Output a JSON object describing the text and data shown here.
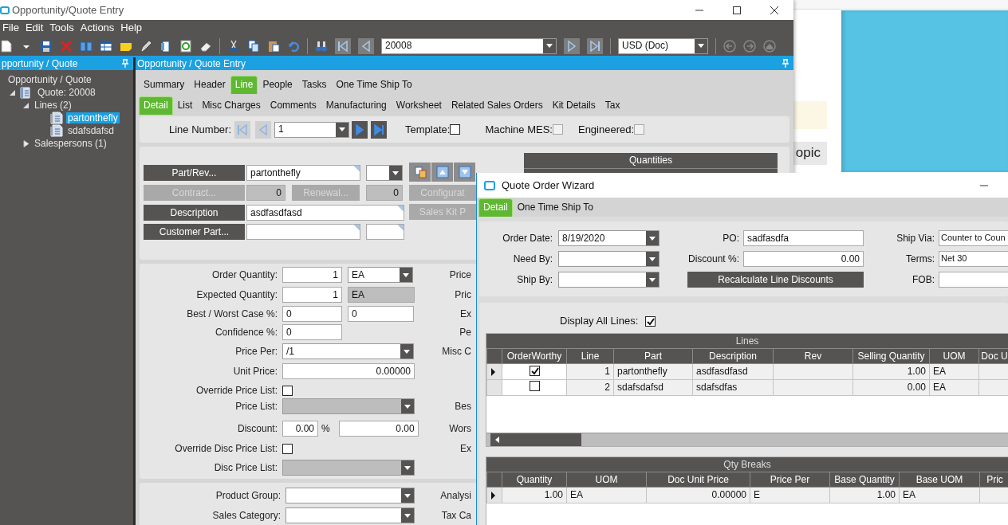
{
  "window": {
    "title": "Opportunity/Quote Entry"
  },
  "menu": [
    "File",
    "Edit",
    "Tools",
    "Actions",
    "Help"
  ],
  "toolbar": {
    "record": "20008",
    "currency": "USD (Doc)"
  },
  "tree_panel": {
    "title": "pportunity / Quote",
    "items": [
      {
        "label": "Opportunity / Quote",
        "selected": false,
        "children": [
          {
            "label": "Quote: 20008",
            "kind": "quote",
            "expanded": true,
            "selected": false,
            "children": [
              {
                "label": "Lines (2)",
                "expanded": true,
                "selected": false,
                "children": [
                  {
                    "label": "partonthefly",
                    "kind": "line",
                    "selected": true
                  },
                  {
                    "label": "sdafsdafsd",
                    "kind": "line",
                    "selected": false
                  }
                ]
              },
              {
                "label": "Salespersons (1)",
                "expanded": false,
                "selected": false
              }
            ]
          }
        ]
      }
    ]
  },
  "entry": {
    "title": "Opportunity / Quote Entry",
    "tabs": [
      {
        "label": "Summary",
        "selected": false
      },
      {
        "label": "Header",
        "selected": false
      },
      {
        "label": "Line",
        "selected": true
      },
      {
        "label": "People",
        "selected": false
      },
      {
        "label": "Tasks",
        "selected": false
      },
      {
        "label": "One Time Ship To",
        "selected": false
      }
    ],
    "subtabs": [
      {
        "label": "Detail",
        "selected": true
      },
      {
        "label": "List",
        "selected": false
      },
      {
        "label": "Misc Charges",
        "selected": false
      },
      {
        "label": "Comments",
        "selected": false
      },
      {
        "label": "Manufacturing",
        "selected": false
      },
      {
        "label": "Worksheet",
        "selected": false
      },
      {
        "label": "Related Sales Orders",
        "selected": false
      },
      {
        "label": "Kit Details",
        "selected": false
      },
      {
        "label": "Tax",
        "selected": false
      }
    ],
    "line_bar": {
      "label": "Line Number:",
      "value": "1",
      "nav": [
        {
          "disabled": true
        },
        {
          "disabled": true
        },
        {
          "disabled": false
        },
        {
          "disabled": false
        }
      ],
      "checks": [
        {
          "label": "Template:",
          "checked": false,
          "disabled": false
        },
        {
          "label": "Machine MES:",
          "checked": false,
          "disabled": true
        },
        {
          "label": "Engineered:",
          "checked": false,
          "disabled": true
        }
      ]
    },
    "part": {
      "part_button": {
        "label": "Part/Rev...",
        "disabled": false
      },
      "part_value": "partonthefly",
      "contract_button": {
        "label": "Contract...",
        "disabled": true
      },
      "contract_value": "0",
      "renewal_button": {
        "label": "Renewal...",
        "disabled": true
      },
      "renewal_value": "0",
      "description_button": {
        "label": "Description",
        "disabled": false
      },
      "description_value": "asdfasdfasd",
      "customer_part_button": {
        "label": "Customer Part...",
        "disabled": false
      },
      "side_buttons": [
        {
          "label": "Configurat",
          "disabled": true
        },
        {
          "label": "Sales Kit P",
          "disabled": true
        }
      ],
      "quantities_title": "Quantities"
    },
    "details": [
      {
        "label": "Order Quantity:",
        "controls": [
          {
            "kind": "number",
            "value": "1"
          },
          {
            "kind": "combo",
            "value": "EA"
          }
        ],
        "side": "Price"
      },
      {
        "label": "Expected Quantity:",
        "controls": [
          {
            "kind": "number",
            "value": "1"
          },
          {
            "kind": "text",
            "value": "EA",
            "disabled": true
          }
        ],
        "side": "Pric"
      },
      {
        "label": "Best / Worst Case %:",
        "controls": [
          {
            "kind": "text",
            "value": "0"
          },
          {
            "kind": "text",
            "value": "0"
          }
        ],
        "side": "Ex"
      },
      {
        "label": "Confidence %:",
        "controls": [
          {
            "kind": "text",
            "value": "0"
          }
        ],
        "side": "Pe"
      },
      {
        "label": "Price Per:",
        "controls": [
          {
            "kind": "combo",
            "value": "/1"
          }
        ],
        "side": "Misc C"
      },
      {
        "label": "Unit Price:",
        "controls": [
          {
            "kind": "number",
            "value": "0.00000"
          }
        ]
      },
      {
        "label": "Override Price List:",
        "controls": [
          {
            "kind": "checkbox",
            "checked": false
          }
        ]
      },
      {
        "label": "Price List:",
        "controls": [
          {
            "kind": "combo",
            "disabled": true
          }
        ],
        "side": "Bes"
      },
      {
        "label": "Discount:",
        "controls": [
          {
            "kind": "number",
            "value": "0.00"
          },
          {
            "kind": "unit",
            "value": "%"
          },
          {
            "kind": "number",
            "value": "0.00"
          }
        ],
        "side": "Wors"
      },
      {
        "label": "Override Disc Price List:",
        "controls": [
          {
            "kind": "checkbox",
            "checked": false
          }
        ],
        "side": "Ex"
      },
      {
        "label": "Disc Price List:",
        "controls": [
          {
            "kind": "combo",
            "disabled": true
          }
        ]
      }
    ],
    "bottom": [
      {
        "label": "Product Group:",
        "controls": [
          {
            "kind": "combo"
          }
        ],
        "side": "Analysi"
      },
      {
        "label": "Sales Category:",
        "controls": [
          {
            "kind": "combo"
          }
        ],
        "side": "Tax Ca"
      }
    ]
  },
  "wizard": {
    "title": "Quote Order Wizard",
    "tabs": [
      {
        "label": "Detail",
        "selected": true
      },
      {
        "label": "One Time Ship To",
        "selected": false
      }
    ],
    "columns": [
      [
        {
          "label": "Order Date:",
          "kind": "combo",
          "value": "8/19/2020"
        },
        {
          "label": "Need By:",
          "kind": "combo"
        },
        {
          "label": "Ship By:",
          "kind": "combo"
        }
      ],
      [
        {
          "label": "PO:",
          "kind": "text",
          "value": "sadfasdfa"
        },
        {
          "label": "Discount %:",
          "kind": "number",
          "value": "0.00"
        },
        {
          "kind": "button",
          "label": "Recalculate Line Discounts"
        }
      ],
      [
        {
          "label": "Ship Via:",
          "kind": "text",
          "value": "Counter to Coun"
        },
        {
          "label": "Terms:",
          "kind": "text",
          "value": "Net 30"
        },
        {
          "label": "FOB:",
          "kind": "text"
        }
      ]
    ],
    "display_all_lines": {
      "label": "Display All Lines:",
      "checked": true
    },
    "lines": {
      "title": "Lines",
      "columns": [
        "OrderWorthy",
        "Line",
        "Part",
        "Description",
        "Rev",
        "Selling Quantity",
        "UOM",
        "Doc U"
      ],
      "rows": [
        {
          "current": true,
          "order_worthy": true,
          "line": "1",
          "part": "partonthefly",
          "description": "asdfasdfasd",
          "selling_quantity": "1.00",
          "uom": "EA"
        },
        {
          "current": false,
          "order_worthy": false,
          "line": "2",
          "part": "sdafsdafsd",
          "description": "sdafsdfas",
          "selling_quantity": "0.00",
          "uom": "EA"
        }
      ]
    },
    "qty_breaks": {
      "title": "Qty Breaks",
      "columns": [
        "Quantity",
        "UOM",
        "Doc Unit Price",
        "Price Per",
        "Base Quantity",
        "Base UOM",
        "Pric"
      ],
      "rows": [
        {
          "current": true,
          "cells": [
            "1.00",
            "EA",
            "0.00000",
            "E",
            "1.00",
            "EA"
          ]
        }
      ]
    }
  },
  "browser": {
    "button": "opic"
  }
}
